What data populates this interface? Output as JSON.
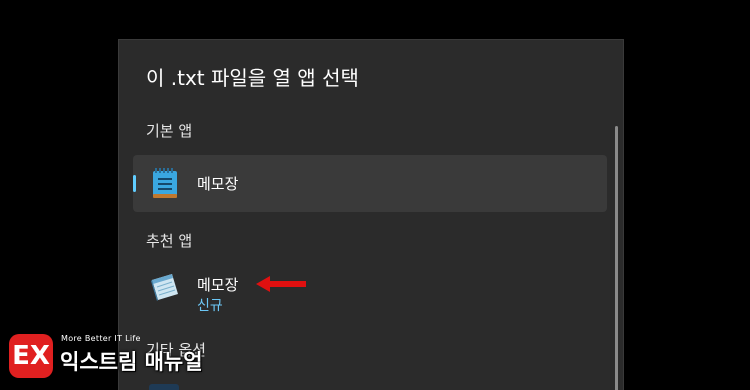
{
  "dialog": {
    "title": "이 .txt 파일을 열 앱 선택",
    "default_section_label": "기본 앱",
    "default_app": {
      "name": "메모장",
      "icon": "notepad-new-icon",
      "selected": true
    },
    "recommended_section_label": "추천 앱",
    "recommended_app": {
      "name": "메모장",
      "badge": "신규",
      "icon": "notepad-classic-icon"
    },
    "other_section_label": "기타 옵션"
  },
  "annotation": {
    "arrow_color": "#e01010",
    "icon": "red-arrow-left-icon"
  },
  "watermark": {
    "logo_text": "EX",
    "tagline": "More Better IT Life",
    "name": "익스트림 매뉴얼"
  },
  "colors": {
    "background": "#000000",
    "dialog_bg": "#2b2b2b",
    "selected_bg": "#3a3a3a",
    "accent": "#60cdff",
    "badge_text": "#6cc7f5"
  }
}
